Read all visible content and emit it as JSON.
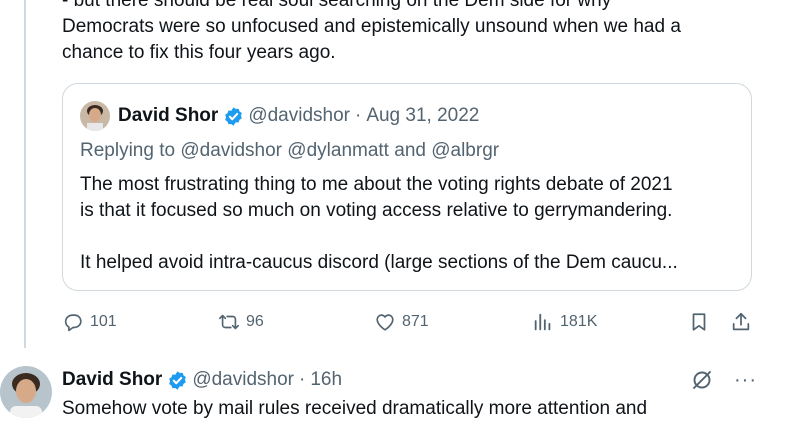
{
  "tweet": {
    "text_lines": [
      "- but there should be real soul searching on the Dem side for why",
      "Democrats were so unfocused and epistemically unsound when we had a",
      "chance to fix this four years ago."
    ]
  },
  "quote": {
    "author_name": "David Shor",
    "handle": "@davidshor",
    "separator": "·",
    "date": "Aug 31, 2022",
    "replying_prefix": "Replying to",
    "replying_to": [
      "@davidshor",
      "@dylanmatt"
    ],
    "replying_and": "and",
    "replying_last": "@albrgr",
    "body_lines": [
      "The most frustrating thing to me about the voting rights debate of 2021",
      "is that it focused so much on voting access relative to gerrymandering.",
      "",
      "It helped avoid intra-caucus discord (large sections of the Dem caucu..."
    ]
  },
  "actions": {
    "replies": "101",
    "reposts": "96",
    "likes": "871",
    "views": "181K"
  },
  "next_tweet": {
    "author_name": "David Shor",
    "handle": "@davidshor",
    "separator": "·",
    "time": "16h",
    "more_label": "···",
    "text": "Somehow vote by mail rules received dramatically more attention and"
  },
  "colors": {
    "text": "#0f1419",
    "muted": "#536471",
    "border": "#cfd9de",
    "verified_blue": "#1d9bf0"
  },
  "icons": [
    "reply-icon",
    "repost-icon",
    "like-icon",
    "views-icon",
    "bookmark-icon",
    "share-icon",
    "verified-icon",
    "grok-icon",
    "more-icon"
  ]
}
